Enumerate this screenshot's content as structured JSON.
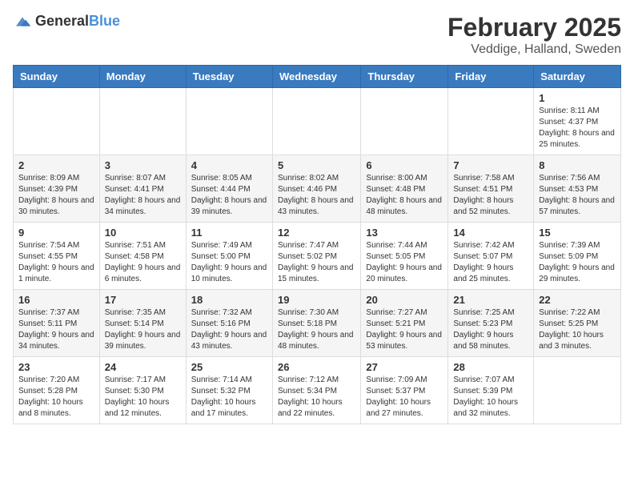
{
  "logo": {
    "general": "General",
    "blue": "Blue"
  },
  "header": {
    "month": "February 2025",
    "location": "Veddige, Halland, Sweden"
  },
  "weekdays": [
    "Sunday",
    "Monday",
    "Tuesday",
    "Wednesday",
    "Thursday",
    "Friday",
    "Saturday"
  ],
  "weeks": [
    [
      {
        "day": "",
        "info": ""
      },
      {
        "day": "",
        "info": ""
      },
      {
        "day": "",
        "info": ""
      },
      {
        "day": "",
        "info": ""
      },
      {
        "day": "",
        "info": ""
      },
      {
        "day": "",
        "info": ""
      },
      {
        "day": "1",
        "info": "Sunrise: 8:11 AM\nSunset: 4:37 PM\nDaylight: 8 hours and 25 minutes."
      }
    ],
    [
      {
        "day": "2",
        "info": "Sunrise: 8:09 AM\nSunset: 4:39 PM\nDaylight: 8 hours and 30 minutes."
      },
      {
        "day": "3",
        "info": "Sunrise: 8:07 AM\nSunset: 4:41 PM\nDaylight: 8 hours and 34 minutes."
      },
      {
        "day": "4",
        "info": "Sunrise: 8:05 AM\nSunset: 4:44 PM\nDaylight: 8 hours and 39 minutes."
      },
      {
        "day": "5",
        "info": "Sunrise: 8:02 AM\nSunset: 4:46 PM\nDaylight: 8 hours and 43 minutes."
      },
      {
        "day": "6",
        "info": "Sunrise: 8:00 AM\nSunset: 4:48 PM\nDaylight: 8 hours and 48 minutes."
      },
      {
        "day": "7",
        "info": "Sunrise: 7:58 AM\nSunset: 4:51 PM\nDaylight: 8 hours and 52 minutes."
      },
      {
        "day": "8",
        "info": "Sunrise: 7:56 AM\nSunset: 4:53 PM\nDaylight: 8 hours and 57 minutes."
      }
    ],
    [
      {
        "day": "9",
        "info": "Sunrise: 7:54 AM\nSunset: 4:55 PM\nDaylight: 9 hours and 1 minute."
      },
      {
        "day": "10",
        "info": "Sunrise: 7:51 AM\nSunset: 4:58 PM\nDaylight: 9 hours and 6 minutes."
      },
      {
        "day": "11",
        "info": "Sunrise: 7:49 AM\nSunset: 5:00 PM\nDaylight: 9 hours and 10 minutes."
      },
      {
        "day": "12",
        "info": "Sunrise: 7:47 AM\nSunset: 5:02 PM\nDaylight: 9 hours and 15 minutes."
      },
      {
        "day": "13",
        "info": "Sunrise: 7:44 AM\nSunset: 5:05 PM\nDaylight: 9 hours and 20 minutes."
      },
      {
        "day": "14",
        "info": "Sunrise: 7:42 AM\nSunset: 5:07 PM\nDaylight: 9 hours and 25 minutes."
      },
      {
        "day": "15",
        "info": "Sunrise: 7:39 AM\nSunset: 5:09 PM\nDaylight: 9 hours and 29 minutes."
      }
    ],
    [
      {
        "day": "16",
        "info": "Sunrise: 7:37 AM\nSunset: 5:11 PM\nDaylight: 9 hours and 34 minutes."
      },
      {
        "day": "17",
        "info": "Sunrise: 7:35 AM\nSunset: 5:14 PM\nDaylight: 9 hours and 39 minutes."
      },
      {
        "day": "18",
        "info": "Sunrise: 7:32 AM\nSunset: 5:16 PM\nDaylight: 9 hours and 43 minutes."
      },
      {
        "day": "19",
        "info": "Sunrise: 7:30 AM\nSunset: 5:18 PM\nDaylight: 9 hours and 48 minutes."
      },
      {
        "day": "20",
        "info": "Sunrise: 7:27 AM\nSunset: 5:21 PM\nDaylight: 9 hours and 53 minutes."
      },
      {
        "day": "21",
        "info": "Sunrise: 7:25 AM\nSunset: 5:23 PM\nDaylight: 9 hours and 58 minutes."
      },
      {
        "day": "22",
        "info": "Sunrise: 7:22 AM\nSunset: 5:25 PM\nDaylight: 10 hours and 3 minutes."
      }
    ],
    [
      {
        "day": "23",
        "info": "Sunrise: 7:20 AM\nSunset: 5:28 PM\nDaylight: 10 hours and 8 minutes."
      },
      {
        "day": "24",
        "info": "Sunrise: 7:17 AM\nSunset: 5:30 PM\nDaylight: 10 hours and 12 minutes."
      },
      {
        "day": "25",
        "info": "Sunrise: 7:14 AM\nSunset: 5:32 PM\nDaylight: 10 hours and 17 minutes."
      },
      {
        "day": "26",
        "info": "Sunrise: 7:12 AM\nSunset: 5:34 PM\nDaylight: 10 hours and 22 minutes."
      },
      {
        "day": "27",
        "info": "Sunrise: 7:09 AM\nSunset: 5:37 PM\nDaylight: 10 hours and 27 minutes."
      },
      {
        "day": "28",
        "info": "Sunrise: 7:07 AM\nSunset: 5:39 PM\nDaylight: 10 hours and 32 minutes."
      },
      {
        "day": "",
        "info": ""
      }
    ]
  ]
}
